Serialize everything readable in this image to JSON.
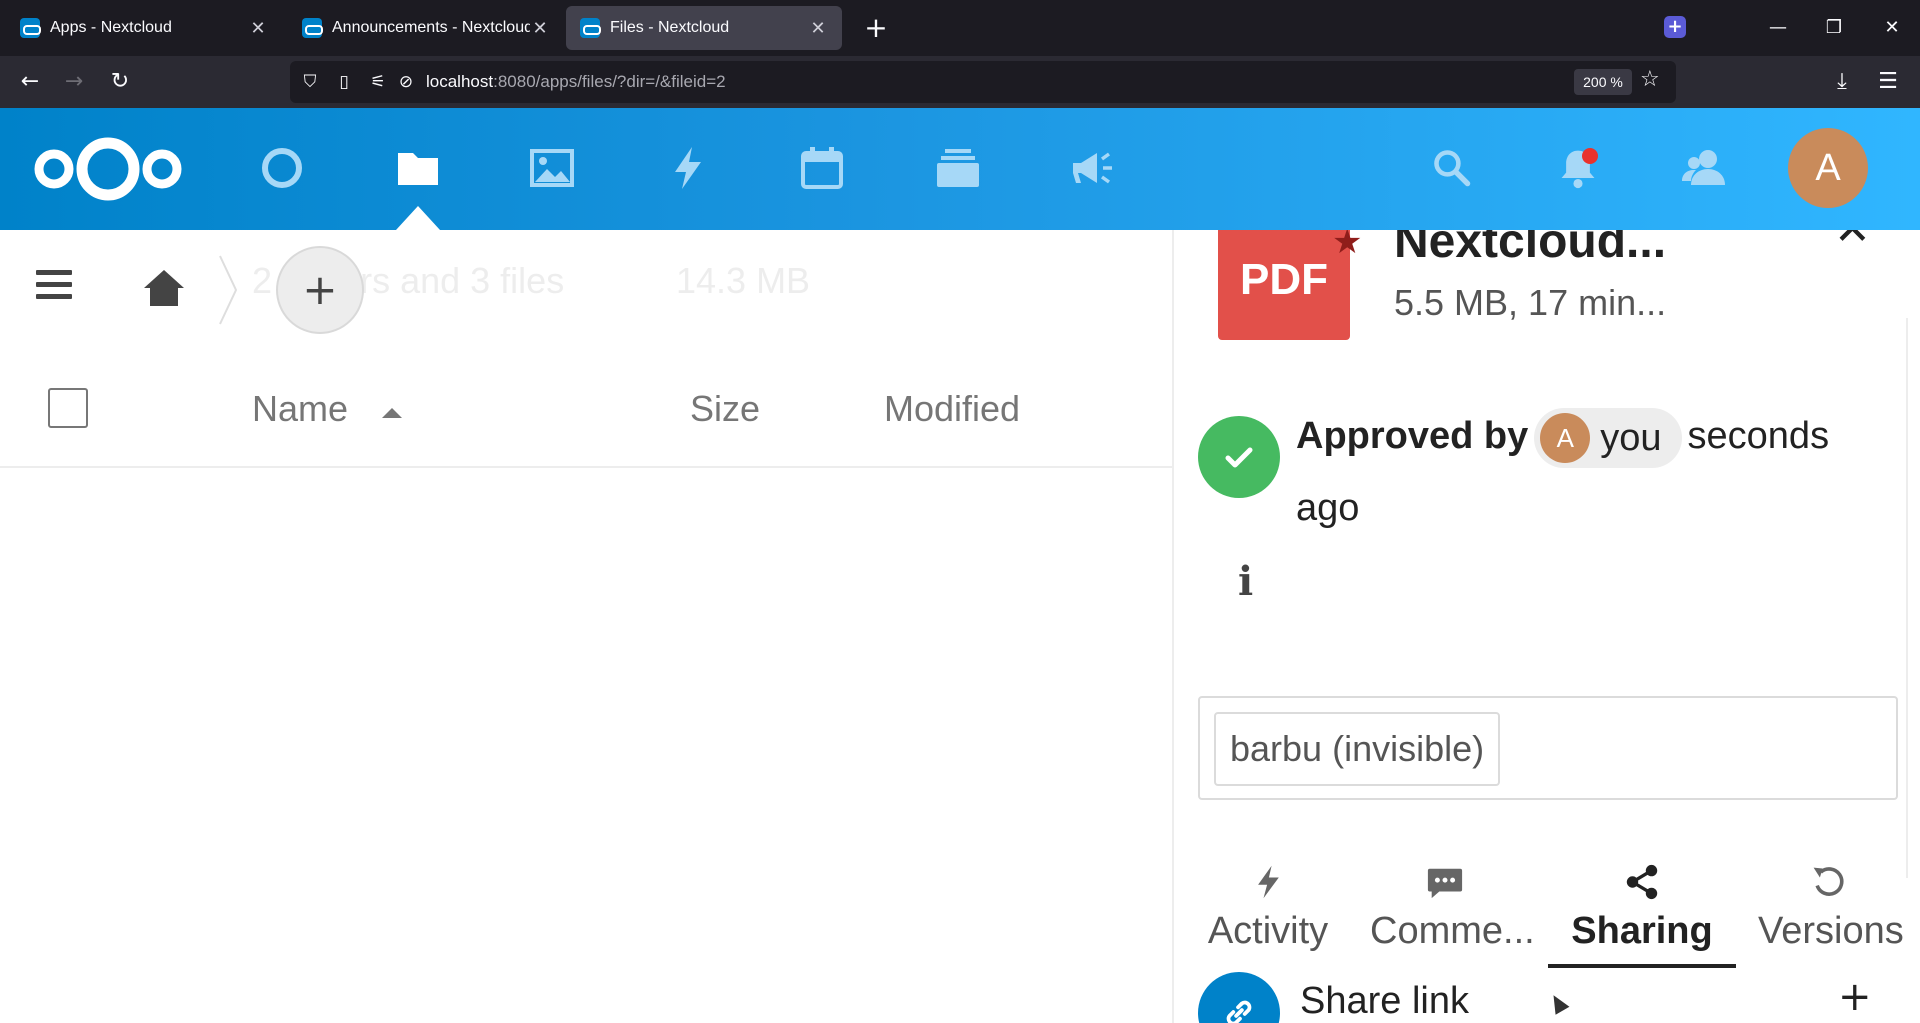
{
  "browser": {
    "tabs": [
      {
        "title": "Apps - Nextcloud",
        "active": false
      },
      {
        "title": "Announcements - Nextcloud",
        "active": false
      },
      {
        "title": "Files - Nextcloud",
        "active": true
      }
    ],
    "url_host": "localhost",
    "url_rest": ":8080/apps/files/?dir=/&fileid=2",
    "zoom": "200 %"
  },
  "header": {
    "apps": [
      "dashboard-icon",
      "files-icon",
      "photos-icon",
      "activity-icon",
      "calendar-icon",
      "deck-icon",
      "announcements-icon"
    ],
    "active_app": "files-icon",
    "user_initial": "A",
    "colors": {
      "header_start": "#0082c9",
      "header_end": "#30b6ff",
      "avatar": "#c98b5b",
      "notification": "#e9322d"
    }
  },
  "files": {
    "summary": "2 folders and 3 files",
    "total_size": "14.3 MB",
    "columns": {
      "name": "Name",
      "size": "Size",
      "modified": "Modified"
    }
  },
  "sidebar": {
    "thumb_label": "PDF",
    "file_name": "Nextcloud...",
    "file_meta": "5.5 MB, 17 min...",
    "approval": {
      "prefix": "Approved by",
      "user_initial": "A",
      "user": "you",
      "suffix": "seconds ago"
    },
    "tag": "barbu (invisible)",
    "tabs": [
      {
        "label": "Activity",
        "icon": "activity-icon"
      },
      {
        "label": "Comme...",
        "icon": "comments-icon"
      },
      {
        "label": "Sharing",
        "icon": "share-icon",
        "active": true
      },
      {
        "label": "Versions",
        "icon": "versions-icon"
      }
    ],
    "share_link_label": "Share link",
    "colors": {
      "pdf": "#e2504a",
      "approved": "#46ba61",
      "share_link": "#0082c9"
    }
  }
}
